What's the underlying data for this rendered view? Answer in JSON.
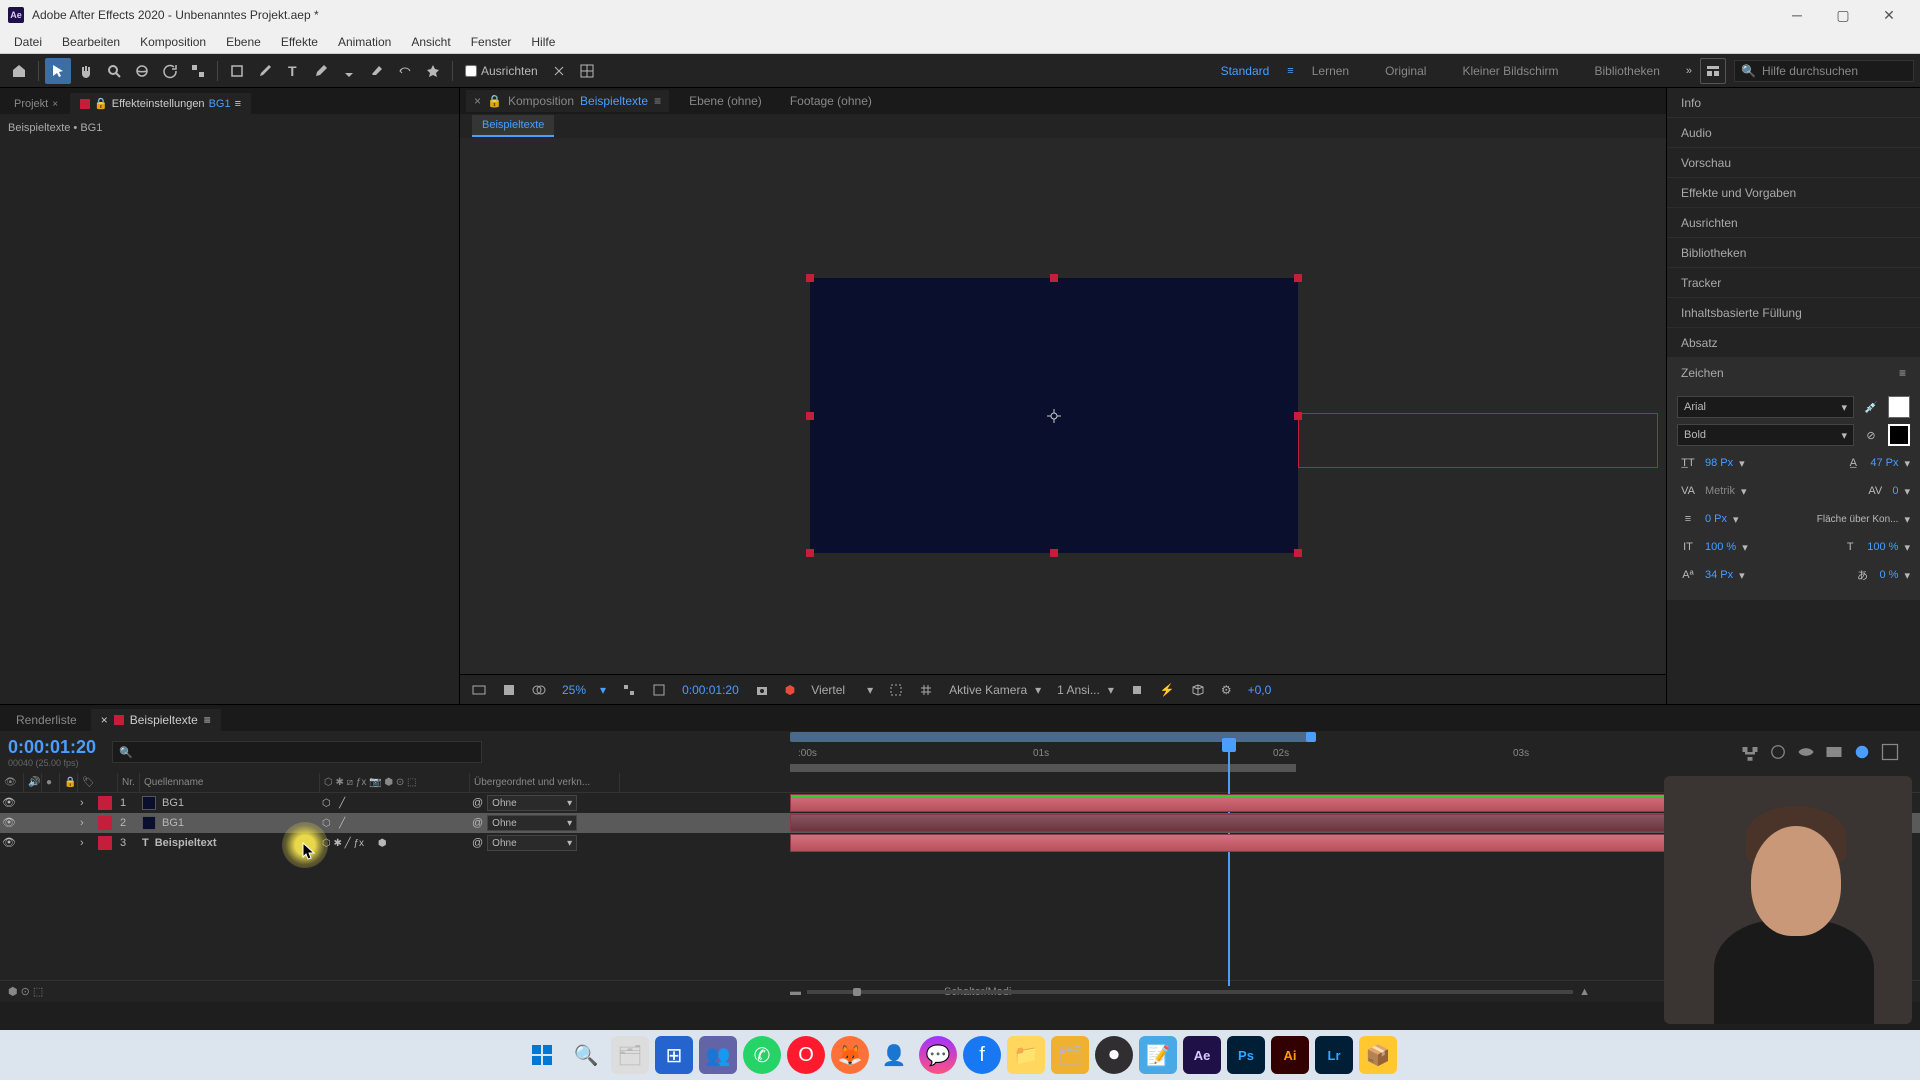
{
  "title": "Adobe After Effects 2020 - Unbenanntes Projekt.aep *",
  "menu": [
    "Datei",
    "Bearbeiten",
    "Komposition",
    "Ebene",
    "Effekte",
    "Animation",
    "Ansicht",
    "Fenster",
    "Hilfe"
  ],
  "toolbar": {
    "align_label": "Ausrichten",
    "search_placeholder": "Hilfe durchsuchen"
  },
  "workspaces": [
    "Standard",
    "Lernen",
    "Original",
    "Kleiner Bildschirm",
    "Bibliotheken"
  ],
  "left_panel": {
    "tab_project": "Projekt",
    "tab_effects": "Effekteinstellungen",
    "tab_effects_target": "BG1",
    "breadcrumb": "Beispieltexte • BG1"
  },
  "center": {
    "tab_comp": "Komposition",
    "comp_name": "Beispieltexte",
    "tab_layer": "Ebene  (ohne)",
    "tab_footage": "Footage  (ohne)",
    "subtab": "Beispieltexte"
  },
  "viewport_bar": {
    "zoom": "25%",
    "timecode": "0:00:01:20",
    "quality": "Viertel",
    "camera": "Aktive Kamera",
    "views": "1 Ansi...",
    "exposure": "+0,0"
  },
  "right_panels": [
    "Info",
    "Audio",
    "Vorschau",
    "Effekte und Vorgaben",
    "Ausrichten",
    "Bibliotheken",
    "Tracker",
    "Inhaltsbasierte Füllung",
    "Absatz",
    "Zeichen"
  ],
  "character": {
    "font": "Arial",
    "weight": "Bold",
    "size": "98 Px",
    "leading": "47 Px",
    "kerning": "Metrik",
    "tracking": "0",
    "stroke": "0 Px",
    "stroke_mode": "Fläche über Kon...",
    "vscale": "100 %",
    "hscale": "100 %",
    "baseline": "34 Px",
    "tsume": "0 %"
  },
  "timeline": {
    "tab_render": "Renderliste",
    "tab_comp": "Beispieltexte",
    "timecode": "0:00:01:20",
    "frame_info": "00040 (25.00 fps)",
    "col_nr": "Nr.",
    "col_source": "Quellenname",
    "col_parent": "Übergeordnet und verkn...",
    "parent_none": "Ohne",
    "footer": "Schalter/Modi",
    "ruler_marks": [
      ":00s",
      "01s",
      "02s",
      "03s"
    ],
    "layers": [
      {
        "nr": "1",
        "name": "BG1",
        "type": "solid"
      },
      {
        "nr": "2",
        "name": "BG1",
        "type": "solid"
      },
      {
        "nr": "3",
        "name": "Beispieltext",
        "type": "text"
      }
    ]
  },
  "taskbar_icons": [
    "windows",
    "search",
    "explorer",
    "edge",
    "teams",
    "whatsapp",
    "opera",
    "firefox",
    "app1",
    "messenger",
    "facebook",
    "folder",
    "app2",
    "obs",
    "notepad",
    "ae",
    "ps",
    "ai",
    "lr",
    "app3"
  ]
}
